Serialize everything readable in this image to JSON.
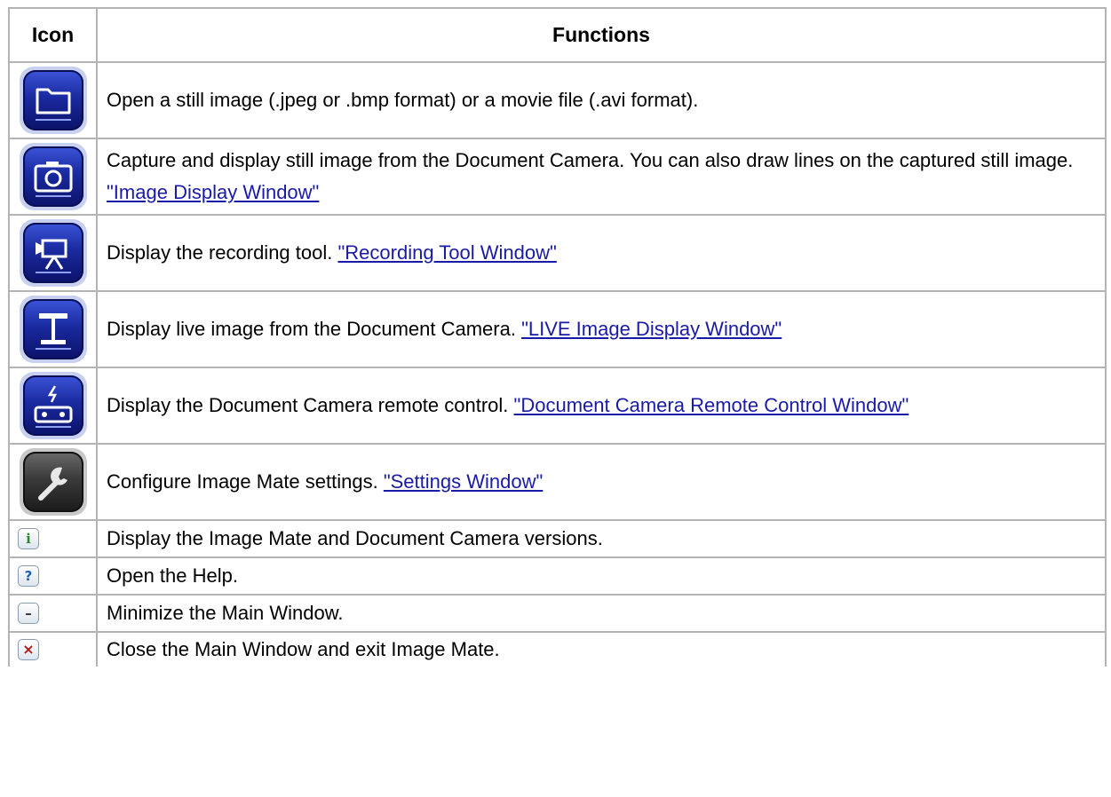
{
  "header": {
    "icon_col": "Icon",
    "functions_col": "Functions"
  },
  "rows": [
    {
      "icon": "folder-icon",
      "text": "Open a still image (.jpeg or .bmp format) or a movie file (.avi format).",
      "link": ""
    },
    {
      "icon": "camera-icon",
      "text": "Capture and display still image from the Document Camera. You can also draw lines on the captured still image. ",
      "link": "\"Image Display Window\""
    },
    {
      "icon": "recorder-icon",
      "text": "Display the recording tool. ",
      "link": "\"Recording Tool Window\""
    },
    {
      "icon": "document-camera-icon",
      "text": "Display live image from the Document Camera. ",
      "link": "\"LIVE Image Display Window\""
    },
    {
      "icon": "remote-control-icon",
      "text": "Display the Document Camera remote control. ",
      "link": "\"Document Camera Remote Control Window\""
    },
    {
      "icon": "wrench-icon",
      "text": "Configure Image Mate settings. ",
      "link": "\"Settings Window\""
    },
    {
      "icon": "info-icon",
      "glyph": "i",
      "text": "Display the Image Mate and Document Camera versions.",
      "link": ""
    },
    {
      "icon": "help-icon",
      "glyph": "?",
      "text": "Open the Help.",
      "link": ""
    },
    {
      "icon": "minimize-icon",
      "glyph": "–",
      "text": "Minimize the Main Window.",
      "link": ""
    },
    {
      "icon": "close-icon",
      "glyph": "×",
      "text": "Close the Main Window and exit Image Mate.",
      "link": ""
    }
  ],
  "colors": {
    "border": "#b4b4b4",
    "link": "#1a1aa8",
    "icon_blue": "#1a2aa0"
  }
}
